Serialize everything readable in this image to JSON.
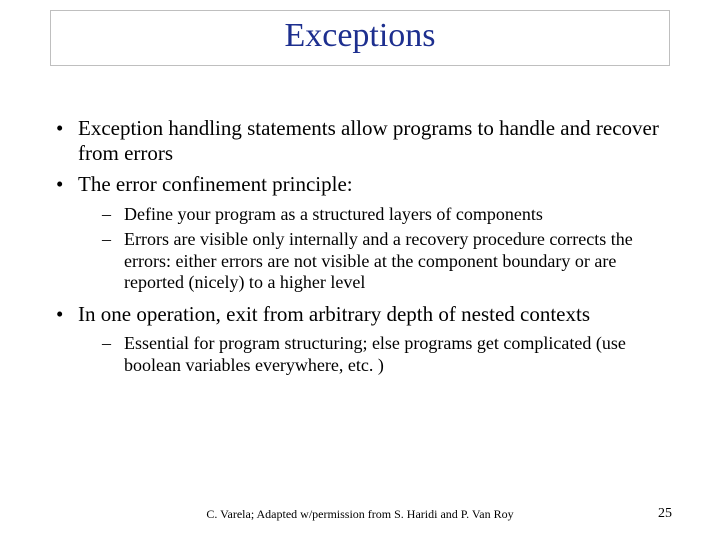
{
  "title": "Exceptions",
  "bullets": [
    {
      "text": "Exception handling statements allow programs to handle and recover from errors",
      "sub": []
    },
    {
      "text": "The error confinement principle:",
      "sub": [
        "Define your program as a structured layers of components",
        "Errors are visible only internally and a recovery procedure corrects the errors: either errors are not visible at the component boundary or are reported (nicely) to a higher level"
      ]
    },
    {
      "text": "In one operation, exit from arbitrary depth of nested contexts",
      "sub": [
        "Essential for program structuring; else programs get complicated (use boolean variables everywhere, etc. )"
      ]
    }
  ],
  "footer": "C. Varela; Adapted w/permission from S. Haridi and P. Van Roy",
  "page": "25"
}
